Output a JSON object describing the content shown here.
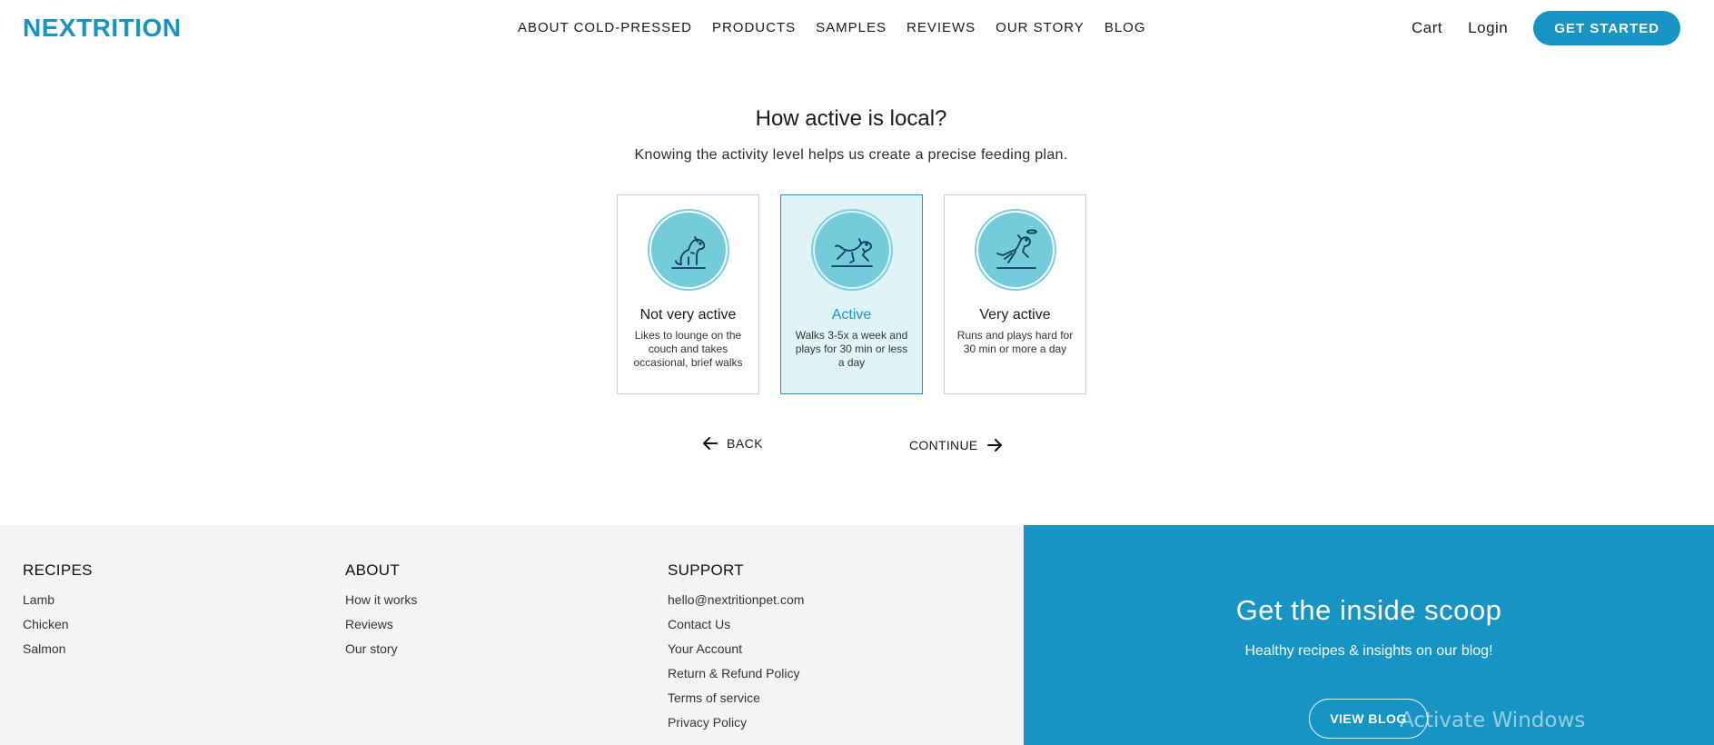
{
  "header": {
    "logo": "NEXTRITION",
    "nav": [
      "ABOUT COLD-PRESSED",
      "PRODUCTS",
      "SAMPLES",
      "REVIEWS",
      "OUR STORY",
      "BLOG"
    ],
    "cart": "Cart",
    "login": "Login",
    "cta": "GET STARTED"
  },
  "question": {
    "title": "How active is local?",
    "subtitle": "Knowing the activity level helps us create a precise feeding plan.",
    "options": [
      {
        "title": "Not very active",
        "desc": "Likes to lounge on the couch and takes occasional, brief walks",
        "icon": "sitting-dog-icon",
        "selected": false
      },
      {
        "title": "Active",
        "desc": "Walks 3-5x a week and plays for 30 min or less a day",
        "icon": "running-dog-icon",
        "selected": true
      },
      {
        "title": "Very active",
        "desc": "Runs and plays hard for 30 min or more a day",
        "icon": "jumping-dog-frisbee-icon",
        "selected": false
      }
    ],
    "back_label": "BACK",
    "continue_label": "CONTINUE"
  },
  "footer": {
    "recipes": {
      "heading": "RECIPES",
      "links": [
        "Lamb",
        "Chicken",
        "Salmon"
      ]
    },
    "about": {
      "heading": "ABOUT",
      "links": [
        "How it works",
        "Reviews",
        "Our story"
      ]
    },
    "support": {
      "heading": "SUPPORT",
      "links": [
        "hello@nextritionpet.com",
        "Contact Us",
        "Your Account",
        "Return & Refund Policy",
        "Terms of service",
        "Privacy Policy"
      ]
    },
    "scoop": {
      "heading": "Get the inside scoop",
      "text": "Healthy recipes & insights on our blog!",
      "button": "VIEW BLOG"
    },
    "watermark": "Activate Windows"
  },
  "colors": {
    "brand": "#1793c4",
    "icon_bg": "#74cbda",
    "selected_bg": "#e0f4f8",
    "footer_bg": "#f4f4f4"
  }
}
